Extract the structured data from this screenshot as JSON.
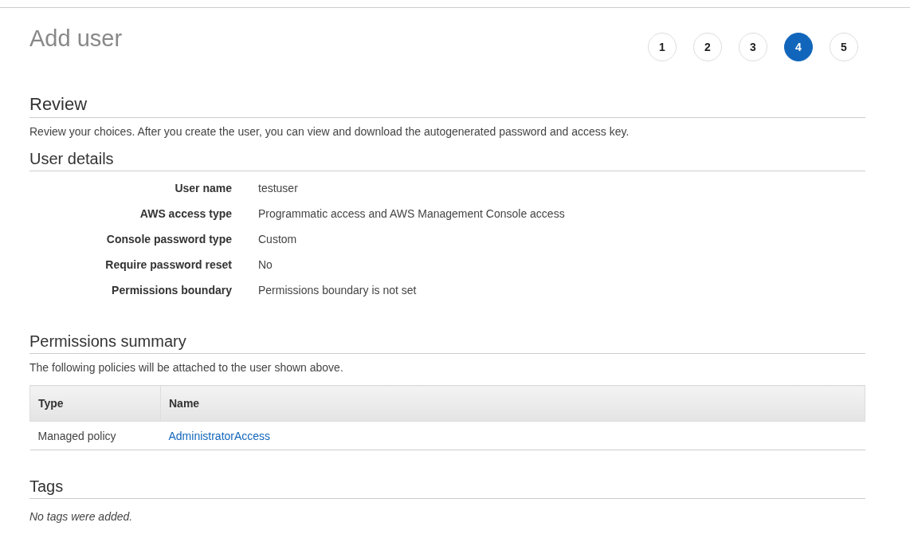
{
  "title": "Add user",
  "steps": [
    {
      "label": "1",
      "selected": false
    },
    {
      "label": "2",
      "selected": false
    },
    {
      "label": "3",
      "selected": false
    },
    {
      "label": "4",
      "selected": true
    },
    {
      "label": "5",
      "selected": false
    }
  ],
  "review": {
    "heading": "Review",
    "description": "Review your choices. After you create the user, you can view and download the autogenerated password and access key."
  },
  "user_details": {
    "heading": "User details",
    "rows": [
      {
        "label": "User name",
        "value": "testuser"
      },
      {
        "label": "AWS access type",
        "value": "Programmatic access and AWS Management Console access"
      },
      {
        "label": "Console password type",
        "value": "Custom"
      },
      {
        "label": "Require password reset",
        "value": "No"
      },
      {
        "label": "Permissions boundary",
        "value": "Permissions boundary is not set"
      }
    ]
  },
  "permissions_summary": {
    "heading": "Permissions summary",
    "description": "The following policies will be attached to the user shown above.",
    "table": {
      "columns": [
        "Type",
        "Name"
      ],
      "rows": [
        {
          "type": "Managed policy",
          "name": "AdministratorAccess"
        }
      ]
    }
  },
  "tags": {
    "heading": "Tags",
    "message": "No tags were added."
  }
}
